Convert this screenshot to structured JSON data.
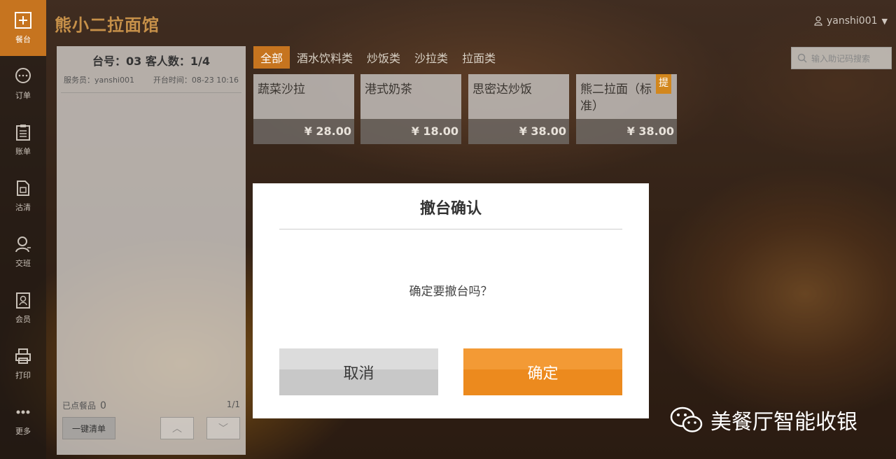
{
  "header": {
    "store_name": "熊小二拉面馆",
    "user": "yanshi001"
  },
  "sidebar": {
    "items": [
      {
        "label": "餐台",
        "icon": "plus-square-icon",
        "active": true
      },
      {
        "label": "订单",
        "icon": "chat-bubble-icon",
        "active": false
      },
      {
        "label": "账单",
        "icon": "clipboard-icon",
        "active": false
      },
      {
        "label": "沽清",
        "icon": "document-icon",
        "active": false
      },
      {
        "label": "交班",
        "icon": "user-icon",
        "active": false
      },
      {
        "label": "会员",
        "icon": "member-card-icon",
        "active": false
      },
      {
        "label": "打印",
        "icon": "printer-icon",
        "active": false
      },
      {
        "label": "更多",
        "icon": "more-dots-icon",
        "active": false
      }
    ]
  },
  "order_panel": {
    "table_info": "台号：03  客人数：1/4",
    "waiter": "服务员：yanshi001",
    "open_time": "开台时间：08-23 10:16",
    "ordered_label": "已点餐品",
    "ordered_count": "0",
    "page": "1/1",
    "clear_button": "一键清单"
  },
  "categories": [
    {
      "label": "全部",
      "active": true
    },
    {
      "label": "酒水饮料类",
      "active": false
    },
    {
      "label": "炒饭类",
      "active": false
    },
    {
      "label": "沙拉类",
      "active": false
    },
    {
      "label": "拉面类",
      "active": false
    }
  ],
  "search": {
    "placeholder": "输入助记码搜索"
  },
  "dishes": [
    {
      "name": "蔬菜沙拉",
      "price": "¥ 28.00"
    },
    {
      "name": "港式奶茶",
      "price": "¥ 18.00"
    },
    {
      "name": "思密达炒饭",
      "price": "¥ 38.00"
    },
    {
      "name": "熊二拉面（标准）",
      "price": "¥ 38.00",
      "tag": "提"
    }
  ],
  "modal": {
    "title": "撤台确认",
    "message": "确定要撤台吗？",
    "cancel": "取消",
    "confirm": "确定"
  },
  "watermark": {
    "text": "美餐厅智能收银",
    "icon": "wechat-icon"
  },
  "colors": {
    "accent": "#c6741f",
    "confirm": "#f39a35"
  }
}
